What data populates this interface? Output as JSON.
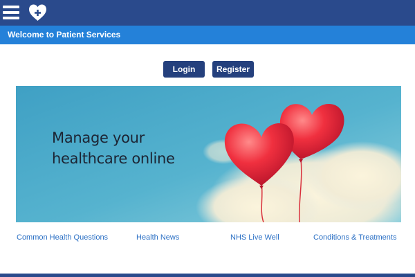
{
  "header": {
    "menu_icon": "hamburger-menu-icon",
    "logo_icon": "heart-plus-logo-icon",
    "colors": {
      "topbar": "#2a4a8c",
      "welcome_band": "#2481d9"
    }
  },
  "welcome": {
    "text": "Welcome to Patient Services"
  },
  "auth": {
    "login_label": "Login",
    "register_label": "Register",
    "button_color": "#24407d"
  },
  "hero": {
    "line1": "Manage your",
    "line2": "healthcare online",
    "image_subject": "red heart balloons in blue sky"
  },
  "links": [
    {
      "label": "Common Health Questions"
    },
    {
      "label": "Health News"
    },
    {
      "label": "NHS Live Well"
    },
    {
      "label": "Conditions & Treatments"
    }
  ],
  "link_color": "#2a6fc4"
}
